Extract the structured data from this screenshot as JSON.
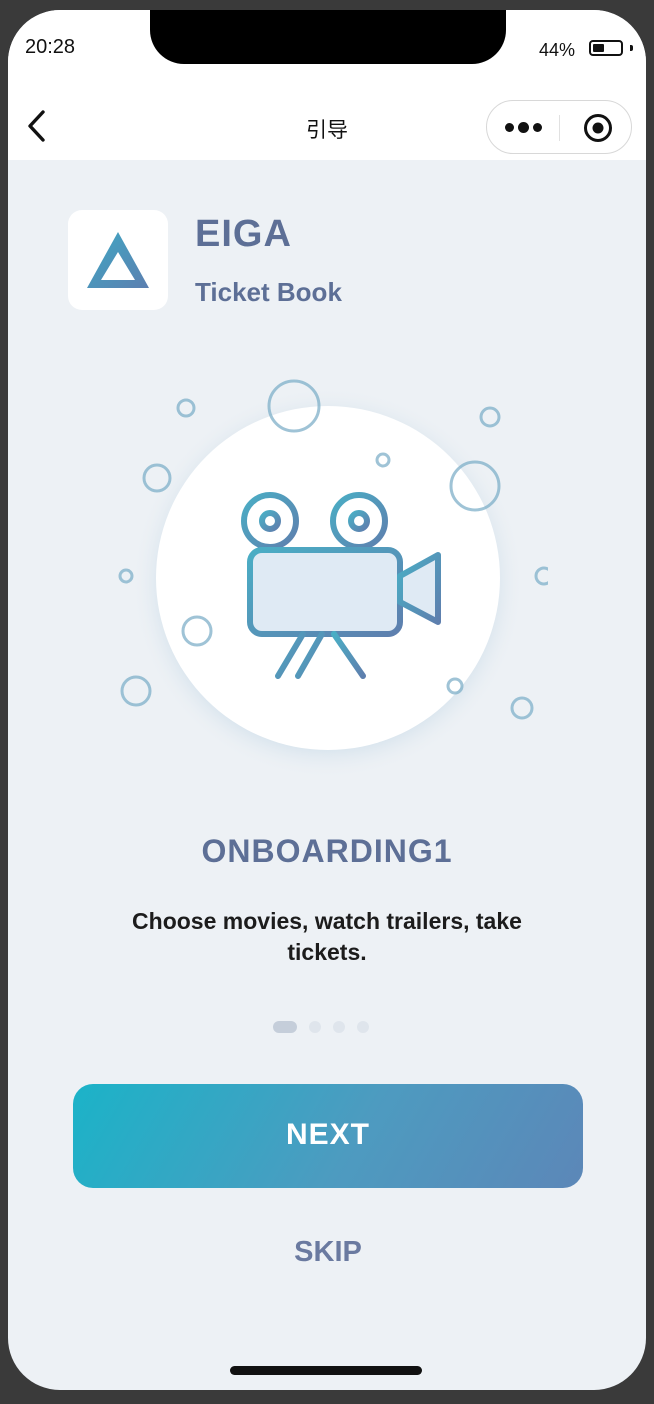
{
  "status_bar": {
    "time": "20:28",
    "battery_text": "44%",
    "battery_level": 0.44
  },
  "nav": {
    "title": "引导"
  },
  "brand": {
    "name": "EIGA",
    "subtitle": "Ticket Book"
  },
  "onboarding": {
    "title": "ONBOARDING1",
    "description": "Choose movies, watch trailers, take tickets.",
    "page_count": 4,
    "active_page": 1
  },
  "actions": {
    "next_label": "NEXT",
    "skip_label": "SKIP"
  },
  "icons": {
    "back": "chevron-left-icon",
    "more": "more-dots-icon",
    "close": "target-close-icon",
    "logo": "triangle-logo-icon",
    "illustration": "movie-camera-icon"
  },
  "colors": {
    "brand_text": "#5d6f96",
    "button_gradient_start": "#1bb3c8",
    "button_gradient_end": "#5c87b8",
    "background": "#edf1f5"
  }
}
